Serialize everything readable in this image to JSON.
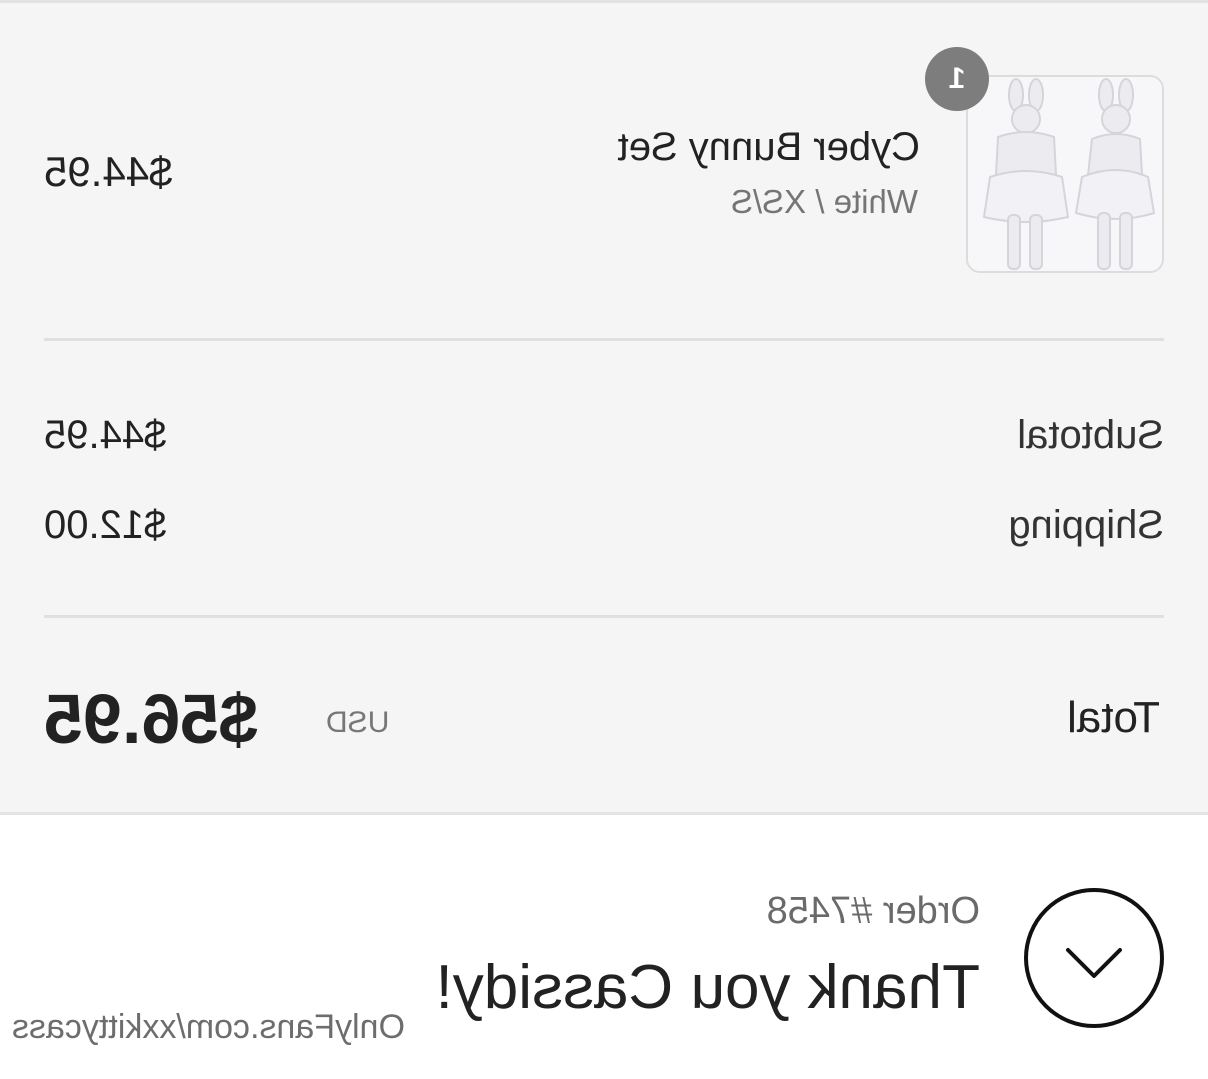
{
  "line_item": {
    "quantity": "1",
    "name": "Cyber Bunny Set",
    "variant": "White / XS/S",
    "price": "$44.95",
    "image_icon": "bunny-costume-photo"
  },
  "summary": {
    "subtotal_label": "Subtotal",
    "subtotal_value": "$44.95",
    "shipping_label": "Shipping",
    "shipping_value": "$12.00",
    "total_label": "Total",
    "total_currency": "USD",
    "total_value": "$56.95"
  },
  "confirmation": {
    "order_number": "Order #7458",
    "thank_you": "Thank you Cassidy!",
    "status_icon": "check-circle-icon"
  },
  "watermark": {
    "text": "OnlyFans.com/xxkittycass"
  },
  "colors": {
    "summary_background": "#f5f5f5",
    "badge": "#7d7d7d",
    "muted_text": "#757575",
    "divider": "#e0e0e0"
  }
}
